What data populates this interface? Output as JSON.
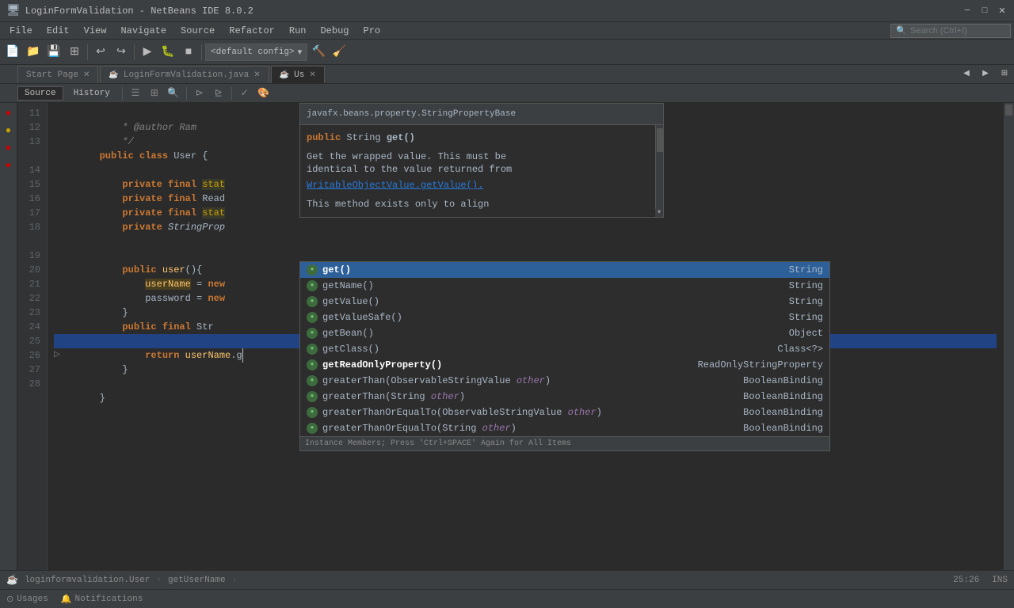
{
  "titleBar": {
    "title": "LoginFormValidation - NetBeans IDE 8.0.2",
    "minimize": "─",
    "restore": "□",
    "close": "✕"
  },
  "menuBar": {
    "items": [
      "File",
      "Edit",
      "View",
      "Navigate",
      "Source",
      "Refactor",
      "Run",
      "Debug",
      "Pro"
    ]
  },
  "toolbar": {
    "config": "<default config>"
  },
  "tabs": [
    {
      "label": "Start Page",
      "active": false
    },
    {
      "label": "LoginFormValidation.java",
      "active": false
    },
    {
      "label": "Us",
      "active": true
    }
  ],
  "secondaryToolbar": {
    "source": "Source",
    "history": "History"
  },
  "lineNumbers": [
    "11",
    "12",
    "13",
    "",
    "14",
    "15",
    "16",
    "17",
    "18",
    "",
    "19",
    "20",
    "21",
    "22",
    "23",
    "24",
    "25",
    "26",
    "27",
    "28"
  ],
  "codeLines": [
    {
      "indent": "    ",
      "content": " * @author Ram",
      "type": "comment"
    },
    {
      "indent": "    ",
      "content": " */",
      "type": "comment"
    },
    {
      "indent": "",
      "content": "public class User {",
      "type": "normal"
    },
    {
      "indent": "",
      "content": "",
      "type": "normal"
    },
    {
      "indent": "    ",
      "content": "private final stat",
      "type": "normal"
    },
    {
      "indent": "    ",
      "content": "private final Read",
      "type": "normal"
    },
    {
      "indent": "    ",
      "content": "private final stat",
      "type": "normal"
    },
    {
      "indent": "    ",
      "content": "private StringProp",
      "type": "normal"
    },
    {
      "indent": "",
      "content": "",
      "type": "normal"
    },
    {
      "indent": "",
      "content": "",
      "type": "normal"
    },
    {
      "indent": "    ",
      "content": "public user(){",
      "type": "normal"
    },
    {
      "indent": "        ",
      "content": "userName = new",
      "type": "normal"
    },
    {
      "indent": "        ",
      "content": "password = new",
      "type": "normal"
    },
    {
      "indent": "    ",
      "content": "}",
      "type": "normal"
    },
    {
      "indent": "    ",
      "content": "public final Str",
      "type": "normal"
    },
    {
      "indent": "        ",
      "content": "return userName.g",
      "type": "normal",
      "cursor": true
    },
    {
      "indent": "    ",
      "content": "}",
      "type": "normal"
    },
    {
      "indent": "",
      "content": "",
      "type": "normal"
    },
    {
      "indent": "}",
      "content": "",
      "type": "normal"
    },
    {
      "indent": "",
      "content": "",
      "type": "normal"
    }
  ],
  "javadoc": {
    "header": "javafx.beans.property.StringPropertyBase",
    "signature": "public String get()",
    "description1": "Get the wrapped value. This must be",
    "description2": "identical to the value returned from",
    "link": "WritableObjectValue.getValue().",
    "description3": "",
    "description4": "This method exists only to align"
  },
  "autocomplete": {
    "items": [
      {
        "name": "get()",
        "returnType": "String",
        "selected": true,
        "bold": true
      },
      {
        "name": "getName()",
        "returnType": "String",
        "selected": false
      },
      {
        "name": "getValue()",
        "returnType": "String",
        "selected": false
      },
      {
        "name": "getValueSafe()",
        "returnType": "String",
        "selected": false
      },
      {
        "name": "getBean()",
        "returnType": "Object",
        "selected": false
      },
      {
        "name": "getClass()",
        "returnType": "Class<?>",
        "selected": false
      },
      {
        "name": "getReadOnlyProperty()",
        "returnType": "ReadOnlyStringProperty",
        "selected": false,
        "bold": true
      },
      {
        "name": "greaterThan(ObservableStringValue other)",
        "returnType": "BooleanBinding",
        "selected": false
      },
      {
        "name": "greaterThan(String other)",
        "returnType": "BooleanBinding",
        "selected": false
      },
      {
        "name": "greaterThanOrEqualTo(ObservableStringValue other)",
        "returnType": "BooleanBinding",
        "selected": false
      },
      {
        "name": "greaterThanOrEqualTo(String other)",
        "returnType": "BooleanBinding",
        "selected": false
      }
    ],
    "footer": "Instance Members; Press 'Ctrl+SPACE' Again for All Items"
  },
  "bottomBar": {
    "breadcrumb1": "loginformvalidation.User",
    "breadcrumb2": "getUserName",
    "position": "25:26",
    "mode": "INS"
  },
  "statusBar": {
    "usages": "Usages",
    "notifications": "Notifications"
  }
}
